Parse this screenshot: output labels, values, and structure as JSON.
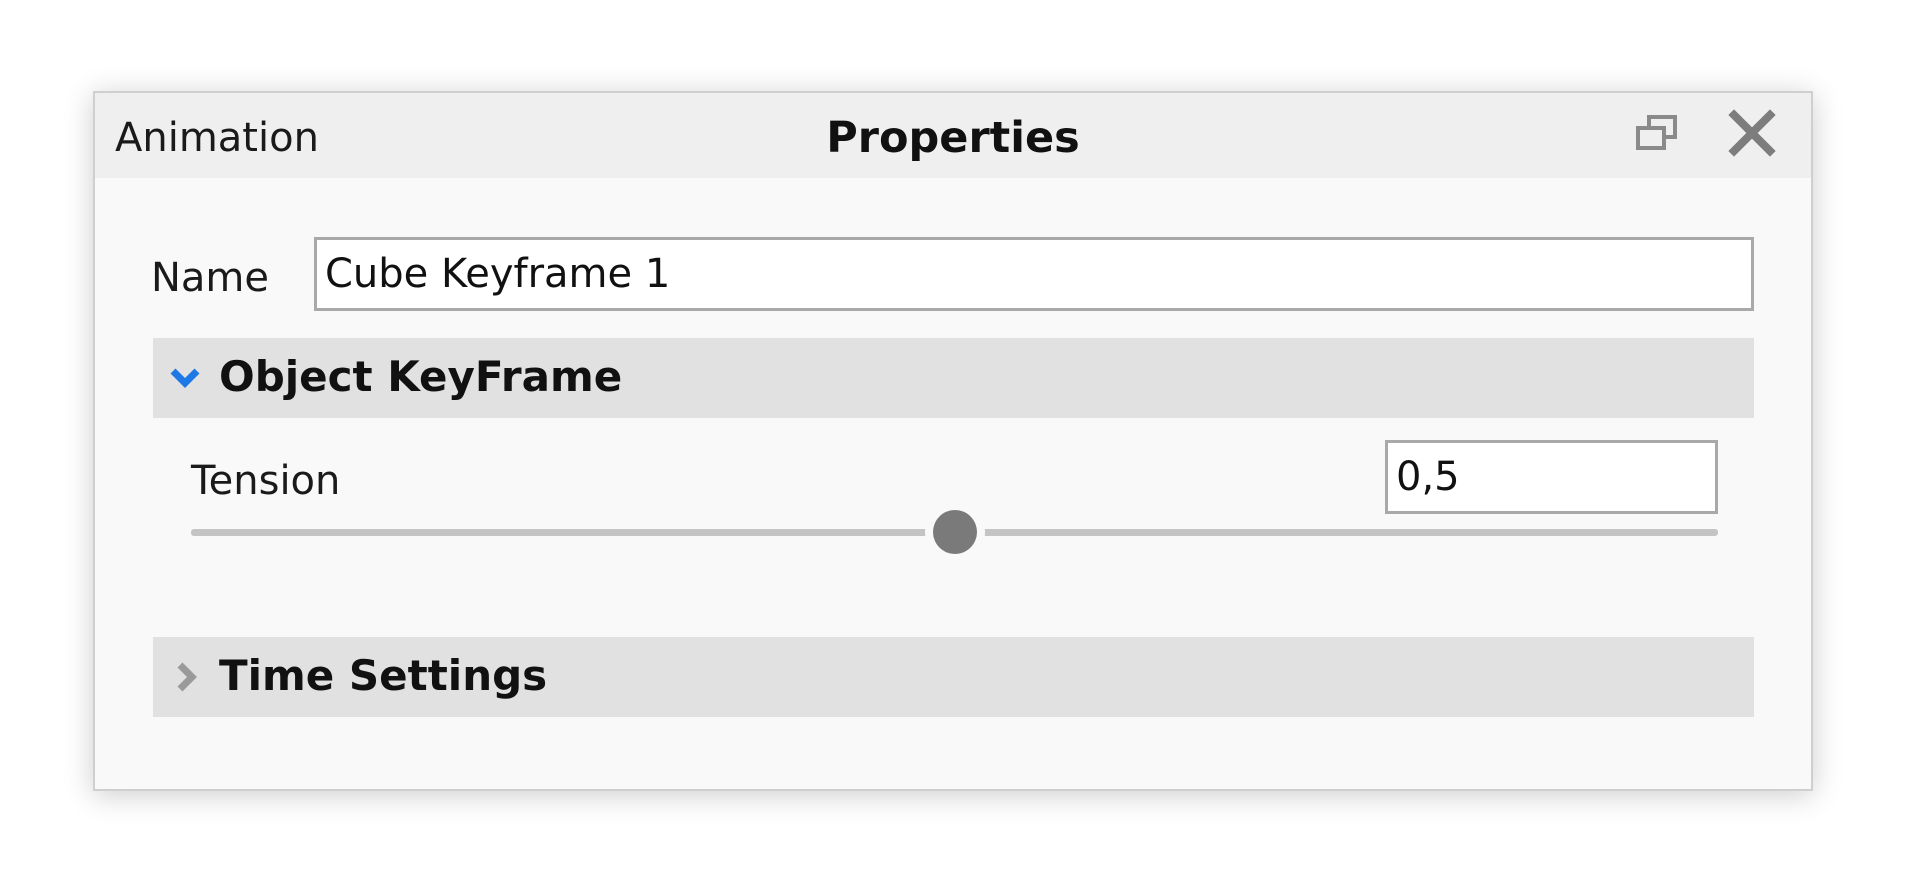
{
  "window": {
    "tab_label": "Animation",
    "title": "Properties",
    "restore_icon": "restore-window-icon",
    "close_icon": "close-icon"
  },
  "form": {
    "name_label": "Name",
    "name_value": "Cube Keyframe 1"
  },
  "sections": {
    "object_keyframe": {
      "label": "Object KeyFrame",
      "expanded": true,
      "icon": "chevron-down-icon",
      "tension": {
        "label": "Tension",
        "value_text": "0,5",
        "value": 0.5,
        "min": 0,
        "max": 1
      }
    },
    "time_settings": {
      "label": "Time Settings",
      "expanded": false,
      "icon": "chevron-right-icon"
    }
  },
  "colors": {
    "accent": "#1e78e6",
    "collapsed_chevron": "#9a9a9a",
    "slider_handle": "#7a7a7a",
    "slider_track": "#c4c4c4"
  }
}
